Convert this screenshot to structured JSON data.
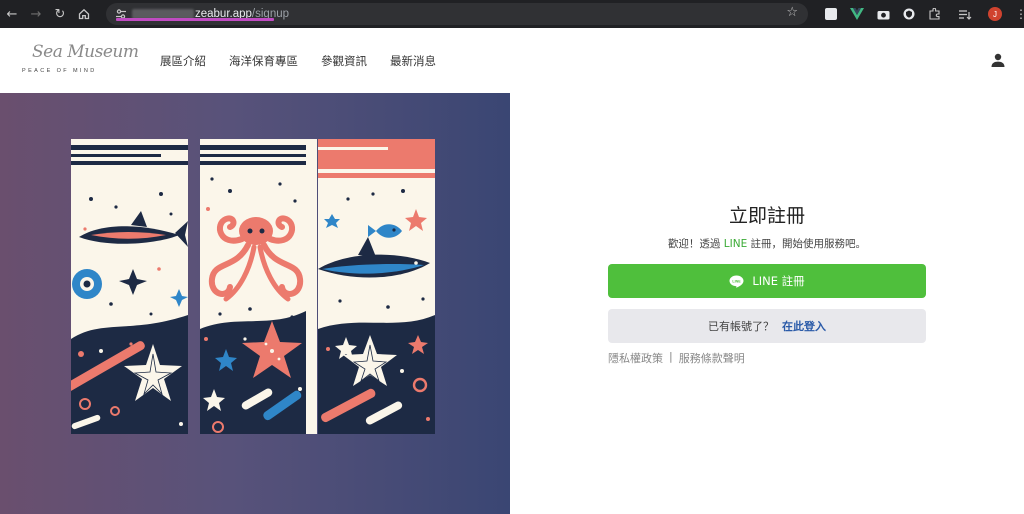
{
  "browser": {
    "url_host": "zeabur.app",
    "url_path": "/signup",
    "profile_initial": "J"
  },
  "header": {
    "logo_script": "Sea Museum",
    "logo_tagline": "PEACE OF MIND",
    "nav": [
      "展區介紹",
      "海洋保育專區",
      "參觀資訊",
      "最新消息"
    ]
  },
  "form": {
    "title": "立即註冊",
    "welcome_prefix": "歡迎！透過 ",
    "welcome_line": "LINE",
    "welcome_suffix": " 註冊，開始使用服務吧。",
    "line_button": "LINE 註冊",
    "have_account": "已有帳號了？",
    "login_link": "在此登入",
    "privacy": "隱私權政策",
    "separator": "|",
    "terms": "服務條款聲明"
  },
  "colors": {
    "line_green": "#4fbf3c",
    "link_blue": "#2a5aa8",
    "illustration_navy": "#1d2a44",
    "illustration_coral": "#ec7a6d",
    "illustration_blue": "#2f86c8"
  }
}
